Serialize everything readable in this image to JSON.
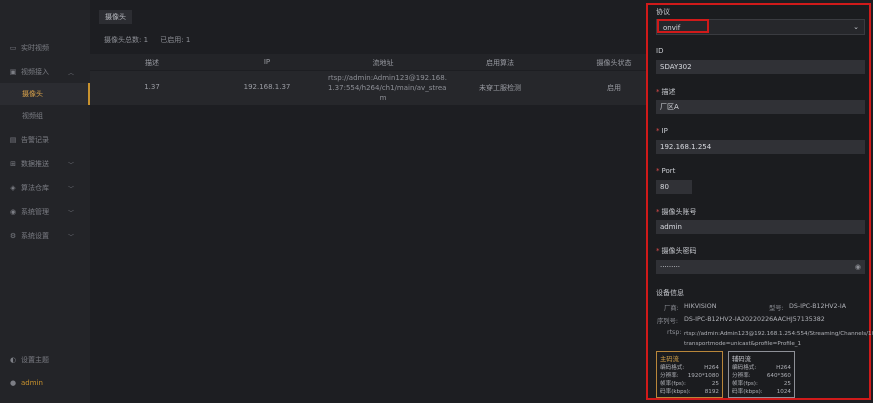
{
  "sidebar": {
    "items": [
      {
        "label": "实时视频",
        "icon": "monitor-icon"
      },
      {
        "label": "视频接入",
        "icon": "video-icon"
      },
      {
        "label": "摄像头"
      },
      {
        "label": "视频组"
      },
      {
        "label": "告警记录",
        "icon": "alarm-icon"
      },
      {
        "label": "数据推送",
        "icon": "push-icon"
      },
      {
        "label": "算法仓库",
        "icon": "cube-icon"
      },
      {
        "label": "系统管理",
        "icon": "admin-icon"
      },
      {
        "label": "系统设置",
        "icon": "settings-icon"
      }
    ],
    "theme_label": "设置主题",
    "user_label": "admin"
  },
  "main": {
    "tab_label": "摄像头",
    "stats": {
      "total": "摄像头总数:  1",
      "enabled": "已启用:  1"
    },
    "columns": [
      "描述",
      "IP",
      "流地址",
      "启用算法",
      "摄像头状态"
    ],
    "row": {
      "desc": "1.37",
      "ip": "192.168.1.37",
      "stream_l1": "rtsp://admin:Admin123@192.168.",
      "stream_l2": "1.37:554/h264/ch1/main/av_strea",
      "stream_l3": "m",
      "algorithm": "未穿工服检测",
      "status": "启用"
    }
  },
  "panel": {
    "protocol_label": "协议",
    "protocol_value": "onvif",
    "id_label": "ID",
    "id_value": "SDAY302",
    "desc_label": "描述",
    "desc_value": "厂区A",
    "ip_label": "IP",
    "ip_value": "192.168.1.254",
    "port_label": "Port",
    "port_value": "80",
    "account_label": "摄像头账号",
    "account_value": "admin",
    "password_label": "摄像头密码",
    "password_value": "·········",
    "device_info_title": "设备信息",
    "vendor_label": "厂商:",
    "vendor_value": "HIKVISION",
    "model_label": "型号:",
    "model_value": "DS-IPC-B12HV2-IA",
    "serial_label": "序列号:",
    "serial_value": "DS-IPC-B12HV2-IA20220226AACHJ57135382",
    "rtsp_label": "rtsp:",
    "rtsp_l1": "rtsp://admin:Admin123@192.168.1.254:554/Streaming/Channels/101?",
    "rtsp_l2": "transportmode=unicast&profile=Profile_1",
    "main_stream": {
      "title": "主码流",
      "codec_k": "编码格式:",
      "codec_v": "H264",
      "res_k": "分辨率:",
      "res_v": "1920*1080",
      "fps_k": "帧率(fps):",
      "fps_v": "25",
      "bitrate_k": "码率(kbps):",
      "bitrate_v": "8192"
    },
    "sub_stream": {
      "title": "辅码流",
      "codec_k": "编码格式:",
      "codec_v": "H264",
      "res_k": "分辨率:",
      "res_v": "640*360",
      "fps_k": "帧率(fps):",
      "fps_v": "25",
      "bitrate_k": "码率(kbps):",
      "bitrate_v": "1024"
    }
  }
}
